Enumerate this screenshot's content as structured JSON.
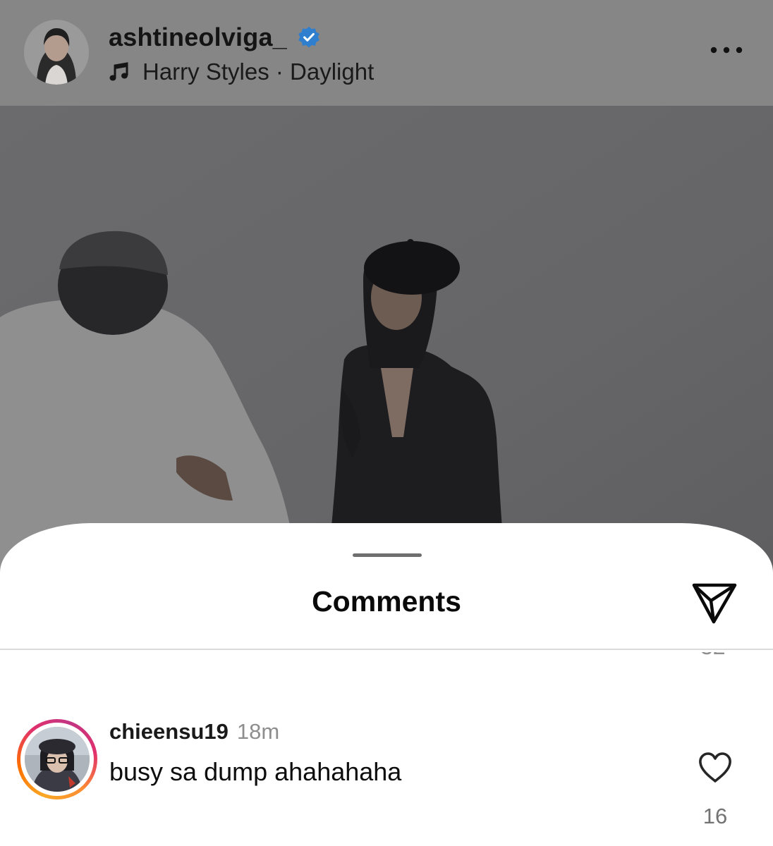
{
  "post": {
    "username": "ashtineolviga_",
    "verified": true,
    "music": "Harry Styles · Daylight"
  },
  "icons": {
    "verified": "verified-badge-icon",
    "music": "music-note-icon",
    "more": "more-options-icon",
    "share": "send-icon",
    "like": "heart-icon"
  },
  "colors": {
    "verified_blue": "#3897f0",
    "overlay_gray": "#868687",
    "story_ring": "#e1306c"
  },
  "comments_sheet": {
    "title": "Comments",
    "comments": [
      {
        "username": "chieensu19",
        "time": "18m",
        "text": "busy sa dump ahahahaha",
        "likes": "16"
      }
    ]
  }
}
